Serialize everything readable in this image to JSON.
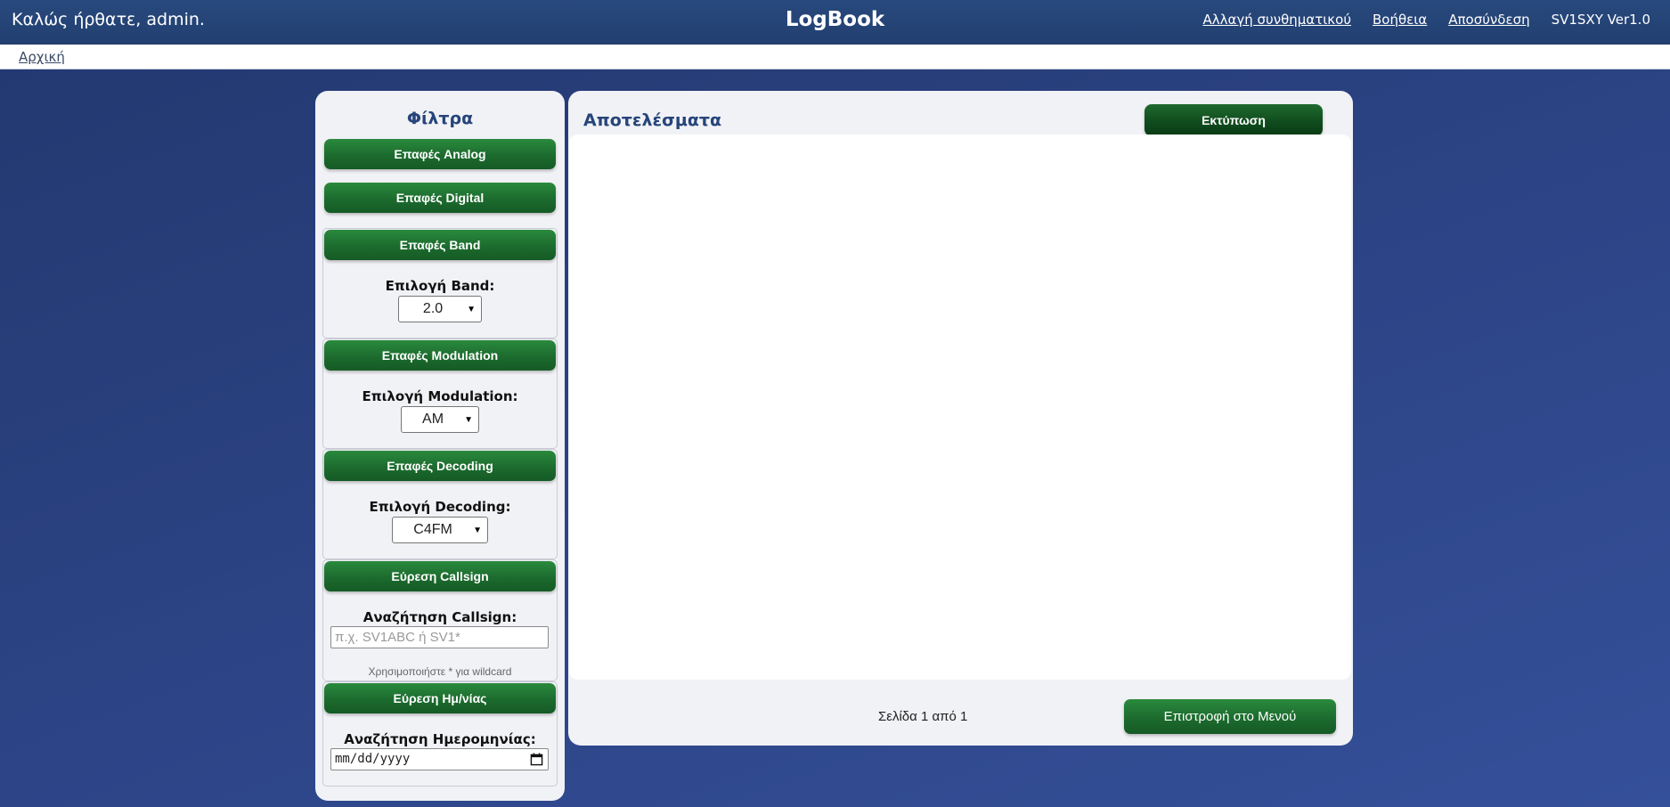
{
  "header": {
    "welcome": "Καλώς ήρθατε, admin.",
    "title": "LogBook",
    "links": {
      "change_password": "Αλλαγή συνθηματικού",
      "help": "Βοήθεια",
      "logout": "Αποσύνδεση"
    },
    "version": "SV1SXY Ver1.0"
  },
  "breadcrumb": {
    "home": "Αρχική"
  },
  "filters": {
    "title": "Φίλτρα",
    "analog_button": "Επαφές Analog",
    "digital_button": "Επαφές Digital",
    "band": {
      "button": "Επαφές Band",
      "label": "Επιλογή Band:",
      "selected": "2.0"
    },
    "modulation": {
      "button": "Επαφές Modulation",
      "label": "Επιλογή Modulation:",
      "selected": "AM"
    },
    "decoding": {
      "button": "Επαφές Decoding",
      "label": "Επιλογή Decoding:",
      "selected": "C4FM"
    },
    "callsign": {
      "button": "Εύρεση Callsign",
      "label": "Αναζήτηση Callsign:",
      "placeholder": "π.χ. SV1ABC ή SV1*",
      "hint": "Χρησιμοποιήστε * για wildcard"
    },
    "date": {
      "button": "Εύρεση Ημ/νίας",
      "label": "Αναζήτηση Ημερομηνίας:",
      "placeholder": "mm/dd/yyyy"
    }
  },
  "results": {
    "title": "Αποτελέσματα",
    "print_button": "Εκτύπωση",
    "page_info": "Σελίδα 1 από 1",
    "back_button": "Επιστροφή στο Μενού"
  },
  "colors": {
    "header_bg": "#223f70",
    "button_green": "#1c6b2e",
    "panel_bg": "#f1f2f6",
    "title_blue": "#26457a"
  }
}
